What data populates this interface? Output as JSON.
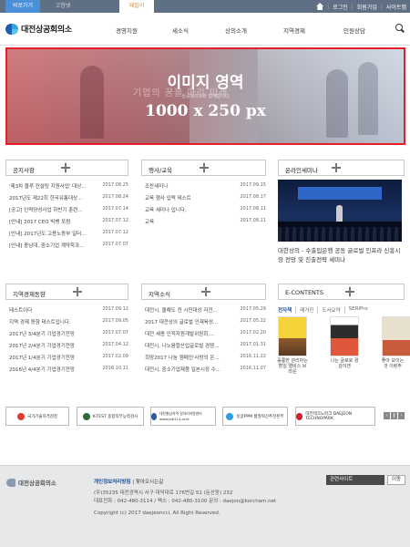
{
  "topbar": {
    "tabs": [
      "비로가기",
      "고창넷",
      "페칼리"
    ],
    "util": [
      "로그인",
      "회원가입",
      "사이트맵"
    ]
  },
  "header": {
    "logo": "대전상공회의소",
    "nav": [
      "경영지원",
      "세소식",
      "상의소개",
      "지역경제",
      "인원상담"
    ]
  },
  "banner": {
    "line1": "이미지 영역",
    "line2": "1000 x 250 px",
    "bg_text": "기업의 꿈을 마리 미래",
    "sub_text": "상공회의소와 함께합니다"
  },
  "panels": {
    "notice": {
      "title": "공지사항",
      "items": [
        {
          "text": "'제3차 블루 컨설팅 지원사업' 대상...",
          "date": "2017.08.25"
        },
        {
          "text": "2017년도 제22회 한국유통대상...",
          "date": "2017.08.24"
        },
        {
          "text": "[공고] 인력양성사업 하반기 훈련...",
          "date": "2017.07.14"
        },
        {
          "text": "[안내] 2017 CEO 빅뱅 포럼",
          "date": "2017.07.12"
        },
        {
          "text": "[안내] 2017년도 고용노동부 일터...",
          "date": "2017.07.12"
        },
        {
          "text": "[안내] 충남대, 중소기업 계약학과...",
          "date": "2017.07.07"
        }
      ]
    },
    "events": {
      "title": "행사/교육",
      "items": [
        {
          "text": "조찬세미나",
          "date": "2017.09.15"
        },
        {
          "text": "교육 행사 입력 테스트",
          "date": "2017.08.17"
        },
        {
          "text": "교육 세미나 입니다.",
          "date": "2017.08.11"
        },
        {
          "text": "교육",
          "date": "2017.08.11"
        }
      ]
    },
    "seminar": {
      "title": "온라인세미나",
      "caption": "대한상의 - 수출입은행 공동 글로벌 인프라 신흥시장 전망 및 진출전략 세미나"
    },
    "regional": {
      "title": "지역경제동향",
      "items": [
        {
          "text": "테스트이다",
          "date": "2017.09.12"
        },
        {
          "text": "지역 경제 동향 테스트입니다.",
          "date": "2017.09.05"
        },
        {
          "text": "2017년 3/4분기 기업경기전망",
          "date": "2017.07.07"
        },
        {
          "text": "2017년 2/4분기 기업경기전망",
          "date": "2017.04.12"
        },
        {
          "text": "2017년 1/4분기 기업경기전망",
          "date": "2017.02.09"
        },
        {
          "text": "2016년 4/4분기 기업경기전망",
          "date": "2016.10.11"
        }
      ]
    },
    "regional_news": {
      "title": "지역소식",
      "items": [
        {
          "text": "대전시, 올해도 전 시민대상 자전...",
          "date": "2017.05.29"
        },
        {
          "text": "2017 대전상의 글로벌 인재육성...",
          "date": "2017.05.22"
        },
        {
          "text": "대전 세종 인적자원개발위원회,...",
          "date": "2017.02.20"
        },
        {
          "text": "대전시, 나노융합산업글로벌 경쟁...",
          "date": "2017.01.31"
        },
        {
          "text": "희망2017 나눔 캠페인'사랑의 온...",
          "date": "2016.11.22"
        },
        {
          "text": "대전시, 중소기업제품 일본시장 수...",
          "date": "2016.11.07"
        }
      ]
    },
    "econtents": {
      "title": "E-CONTENTS",
      "tabs": [
        "전자책",
        "매거진",
        "도서요약",
        "SERIPro"
      ],
      "books": [
        {
          "caption": "훌륭한 관리자는 할일 엘비스 브라운"
        },
        {
          "caption": "나는 글로로 경 김이겐"
        },
        {
          "caption": "좋아 보이는 것 이랑주"
        }
      ]
    }
  },
  "partners": [
    {
      "label": "국가기술자격검정",
      "color": "#e23b2e"
    },
    {
      "label": "K-TEST 종합직무능력검사",
      "color": "#2d6b3c"
    },
    {
      "label": "대전충남지역 일자리지원센터 www.job114.or.kr",
      "color": "#2c5aa0"
    },
    {
      "label": "싱글PPM 품질혁신추진본부",
      "color": "#2f9be0"
    },
    {
      "label": "대전테크노파크 DAEJEON TECHNOPARK",
      "color": "#d21f2c"
    }
  ],
  "footer": {
    "logo": "대전상공회의소",
    "policy": "개인정보처리방침",
    "email_refuse": "| 찾아오시는길",
    "address": "(우)35235 대전광역시 서구 대덕대로 176번길 51 (둔산동) 232",
    "tel": "대표전화 : 042-480-3114 / 팩스 : 042-480-3100 문의 : daejon@korcham.net",
    "copyright": "Copyright (c) 2017 daejeoncci, All Right Reserved.",
    "related_select": "관련사이트",
    "go_button": "이동"
  }
}
